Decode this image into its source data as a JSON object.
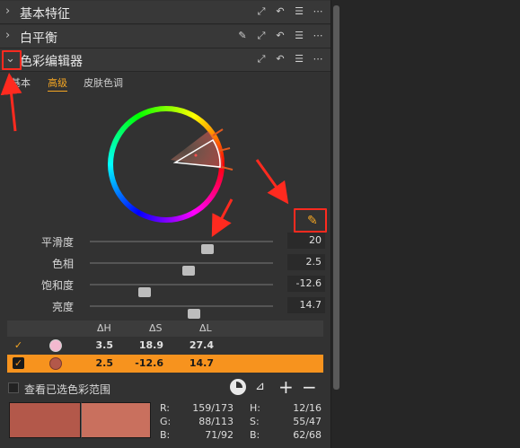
{
  "sections": {
    "basic": {
      "title": "基本特征"
    },
    "wb": {
      "title": "白平衡"
    },
    "color_editor": {
      "title": "色彩编辑器"
    }
  },
  "tabs": [
    "基本",
    "高级",
    "皮肤色调"
  ],
  "active_tab": "高级",
  "sliders": [
    {
      "label": "平滑度",
      "value": "20",
      "position": 0.64
    },
    {
      "label": "色相",
      "value": "2.5",
      "position": 0.54
    },
    {
      "label": "饱和度",
      "value": "-12.6",
      "position": 0.3
    },
    {
      "label": "亮度",
      "value": "14.7",
      "position": 0.57
    }
  ],
  "table": {
    "headers": [
      "ΔH",
      "ΔS",
      "ΔL"
    ],
    "rows": [
      {
        "checked": true,
        "swatch": "#f3b9cf",
        "dh": "3.5",
        "ds": "18.9",
        "dl": "27.4",
        "selected": false
      },
      {
        "checked": true,
        "swatch": "#b3584a",
        "dh": "2.5",
        "ds": "-12.6",
        "dl": "14.7",
        "selected": true
      }
    ]
  },
  "view_selected_label": "查看已选色彩范围",
  "readout": {
    "R": "159/173",
    "G": "88/113",
    "B": "71/92",
    "H": "12/16",
    "S": "55/47",
    "Bv": "62/68"
  },
  "colors": {
    "accent": "#f5a623",
    "highlight_row": "#f7931e",
    "annotation": "#ff2a1f"
  },
  "icons": [
    "chevron-right-icon",
    "chevron-down-icon",
    "copy-icon",
    "reset-icon",
    "list-icon",
    "more-icon",
    "eyedropper-icon",
    "picker-icon",
    "add-icon",
    "remove-icon"
  ]
}
